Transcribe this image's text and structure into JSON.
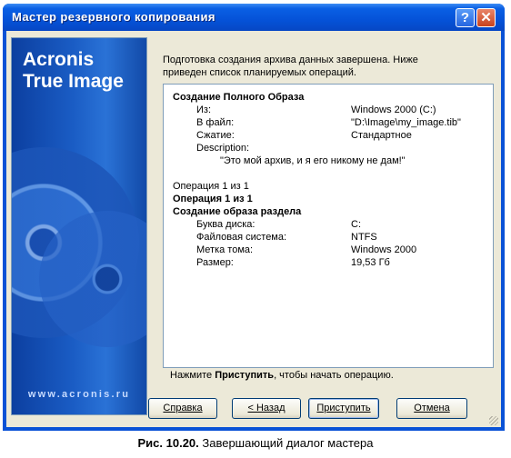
{
  "window": {
    "title": "Мастер резервного копирования"
  },
  "banner": {
    "brand_line1": "Acronis",
    "brand_line2": "True Image",
    "url": "www.acronis.ru"
  },
  "intro": "Подготовка создания архива данных завершена. Ниже приведен список планируемых операций.",
  "summary": {
    "heading1": "Создание Полного Образа",
    "rows1": [
      {
        "label": "Из:",
        "value": "Windows 2000 (C:)"
      },
      {
        "label": "В файл:",
        "value": "\"D:\\Image\\my_image.tib\""
      },
      {
        "label": "Сжатие:",
        "value": "Стандартное"
      }
    ],
    "description_label": "Description:",
    "description_value": "\"Это мой архив, и я его никому не дам!\"",
    "op_plain": "Операция 1 из 1",
    "op_bold": "Операция 1 из 1",
    "heading2": "Создание образа раздела",
    "rows2": [
      {
        "label": "Буква диска:",
        "value": "C:"
      },
      {
        "label": "Файловая система:",
        "value": "NTFS"
      },
      {
        "label": "Метка тома:",
        "value": "Windows 2000"
      },
      {
        "label": "Размер:",
        "value": "19,53 Гб"
      }
    ]
  },
  "footer": {
    "prefix": "Нажмите ",
    "action": "Приступить",
    "suffix": ", чтобы начать операцию."
  },
  "buttons": {
    "help": "Справка",
    "back": "< Назад",
    "proceed": "Приступить",
    "cancel": "Отмена"
  },
  "caption": {
    "label": "Рис. 10.20.",
    "text": " Завершающий диалог мастера"
  }
}
